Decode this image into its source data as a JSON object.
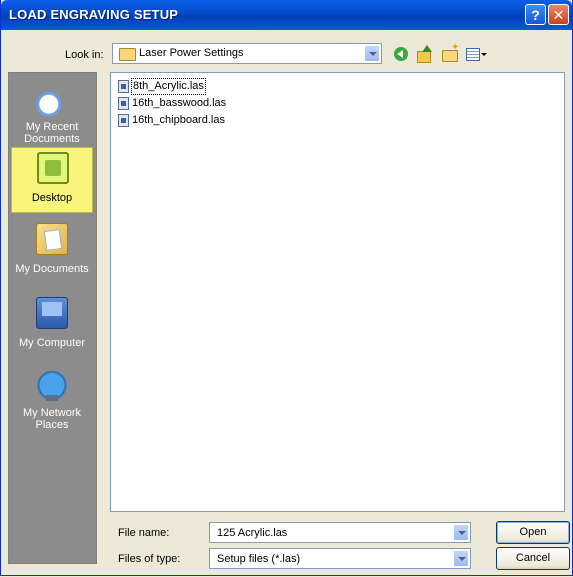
{
  "window": {
    "title": "LOAD ENGRAVING SETUP",
    "help_glyph": "?",
    "close_glyph": "✕"
  },
  "lookin": {
    "label": "Look in:",
    "value": "Laser Power Settings"
  },
  "toolbar": {
    "icons": [
      "back-icon",
      "up-folder-icon",
      "new-folder-icon",
      "views-menu-icon"
    ]
  },
  "places": [
    {
      "label": "My Recent Documents",
      "icon": "recent-documents-icon",
      "selected": false
    },
    {
      "label": "Desktop",
      "icon": "desktop-icon",
      "selected": true
    },
    {
      "label": "My Documents",
      "icon": "my-documents-icon",
      "selected": false
    },
    {
      "label": "My Computer",
      "icon": "my-computer-icon",
      "selected": false
    },
    {
      "label": "My Network Places",
      "icon": "network-places-icon",
      "selected": false
    }
  ],
  "files": [
    {
      "name": "8th_Acrylic.las"
    },
    {
      "name": "16th_basswood.las"
    },
    {
      "name": "16th_chipboard.las"
    }
  ],
  "form": {
    "filename_label": "File name:",
    "filename_value": "125 Acrylic.las",
    "filetype_label": "Files of type:",
    "filetype_value": "Setup files (*.las)"
  },
  "buttons": {
    "open": "Open",
    "cancel": "Cancel"
  },
  "colors": {
    "title_bar": "#0548c8",
    "places_bg": "#8c8c8c",
    "selected_place": "#f8f57a"
  }
}
